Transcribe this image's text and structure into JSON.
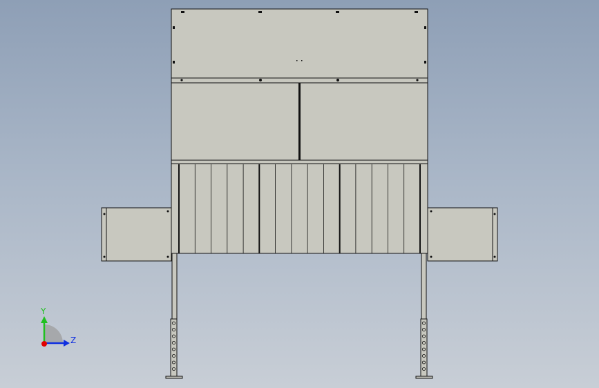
{
  "viewport": {
    "background_top": "#8e9fb6",
    "background_bottom": "#c8ced6"
  },
  "model": {
    "fill_color": "#c8c8bf",
    "edge_color": "#111111",
    "louver_count": 16
  },
  "triad": {
    "x_color": "#e00000",
    "y_color": "#20c020",
    "z_color": "#1030e0",
    "y_label": "Y",
    "z_label": "Z"
  }
}
